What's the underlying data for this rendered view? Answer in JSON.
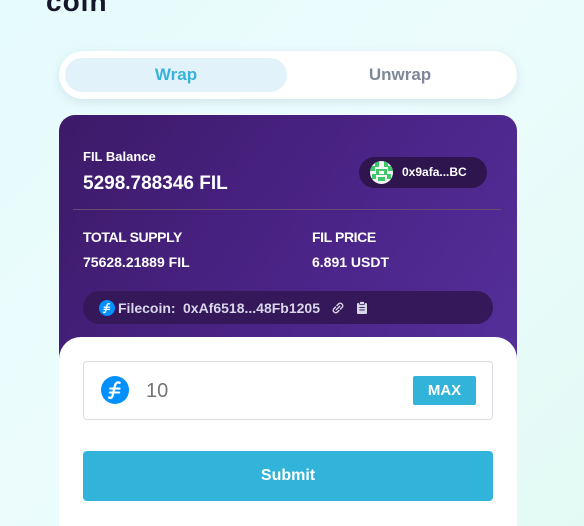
{
  "brand": {
    "partial_text": "coin"
  },
  "tabs": [
    {
      "label": "Wrap",
      "active": true
    },
    {
      "label": "Unwrap",
      "active": false
    }
  ],
  "balance": {
    "label": "FIL Balance",
    "value": "5298.788346 FIL"
  },
  "wallet": {
    "address": "0x9afa...BC",
    "avatar_icon": "identicon-avatar"
  },
  "stats": {
    "total_supply_label": "TOTAL SUPPLY",
    "total_supply_value": "75628.21889 FIL",
    "price_label": "FIL PRICE",
    "price_value": "6.891 USDT"
  },
  "contract": {
    "icon": "filecoin-icon",
    "label": "Filecoin:",
    "address": "0xAf6518...48Fb1205",
    "actions": [
      "link-icon",
      "copy-icon"
    ]
  },
  "form": {
    "token_icon": "filecoin-icon",
    "amount_placeholder": "10",
    "max_label": "MAX",
    "submit_label": "Submit"
  },
  "colors": {
    "accent": "#31b3da",
    "card_purple": "#4b2488",
    "tab_active_bg": "#e2f2fb",
    "filecoin_blue": "#0090ff"
  }
}
